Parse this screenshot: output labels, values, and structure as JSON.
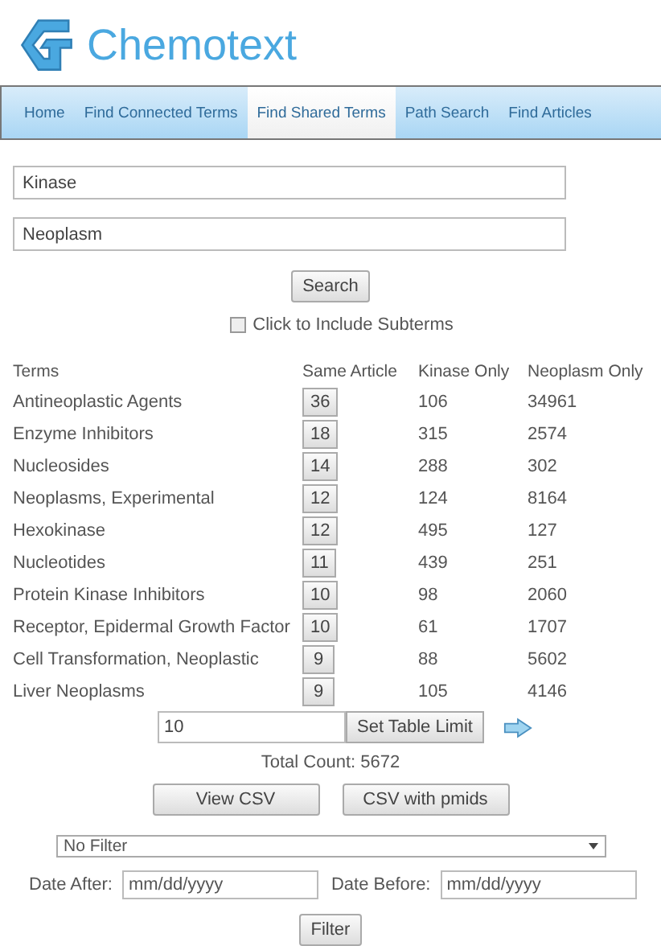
{
  "brand": "Chemotext",
  "nav": [
    {
      "label": "Home",
      "selected": false
    },
    {
      "label": "Find Connected Terms",
      "selected": false
    },
    {
      "label": "Find Shared Terms",
      "selected": true
    },
    {
      "label": "Path Search",
      "selected": false
    },
    {
      "label": "Find Articles",
      "selected": false
    }
  ],
  "term_inputs": [
    {
      "value": "Kinase"
    },
    {
      "value": "Neoplasm"
    }
  ],
  "search_button": "Search",
  "subterms": {
    "label": "Click to Include Subterms",
    "checked": false
  },
  "table": {
    "columns": [
      "Terms",
      "Same Article",
      "Kinase Only",
      "Neoplasm Only"
    ],
    "rows": [
      {
        "term": "Antineoplastic Agents",
        "same": "36",
        "first": "106",
        "second": "34961"
      },
      {
        "term": "Enzyme Inhibitors",
        "same": "18",
        "first": "315",
        "second": "2574"
      },
      {
        "term": "Nucleosides",
        "same": "14",
        "first": "288",
        "second": "302"
      },
      {
        "term": "Neoplasms, Experimental",
        "same": "12",
        "first": "124",
        "second": "8164"
      },
      {
        "term": "Hexokinase",
        "same": "12",
        "first": "495",
        "second": "127"
      },
      {
        "term": "Nucleotides",
        "same": "11",
        "first": "439",
        "second": "251"
      },
      {
        "term": "Protein Kinase Inhibitors",
        "same": "10",
        "first": "98",
        "second": "2060"
      },
      {
        "term": "Receptor, Epidermal Growth Factor",
        "same": "10",
        "first": "61",
        "second": "1707"
      },
      {
        "term": "Cell Transformation, Neoplastic",
        "same": "9",
        "first": "88",
        "second": "5602"
      },
      {
        "term": "Liver Neoplasms",
        "same": "9",
        "first": "105",
        "second": "4146"
      }
    ]
  },
  "limit": {
    "value": "10",
    "button": "Set Table Limit"
  },
  "total_count": "Total Count: 5672",
  "csv_buttons": [
    "View CSV",
    "CSV with pmids"
  ],
  "filter_select": "No Filter",
  "dates": [
    {
      "label": "Date After:",
      "placeholder": "mm/dd/yyyy"
    },
    {
      "label": "Date Before:",
      "placeholder": "mm/dd/yyyy"
    }
  ],
  "filter_button": "Filter"
}
